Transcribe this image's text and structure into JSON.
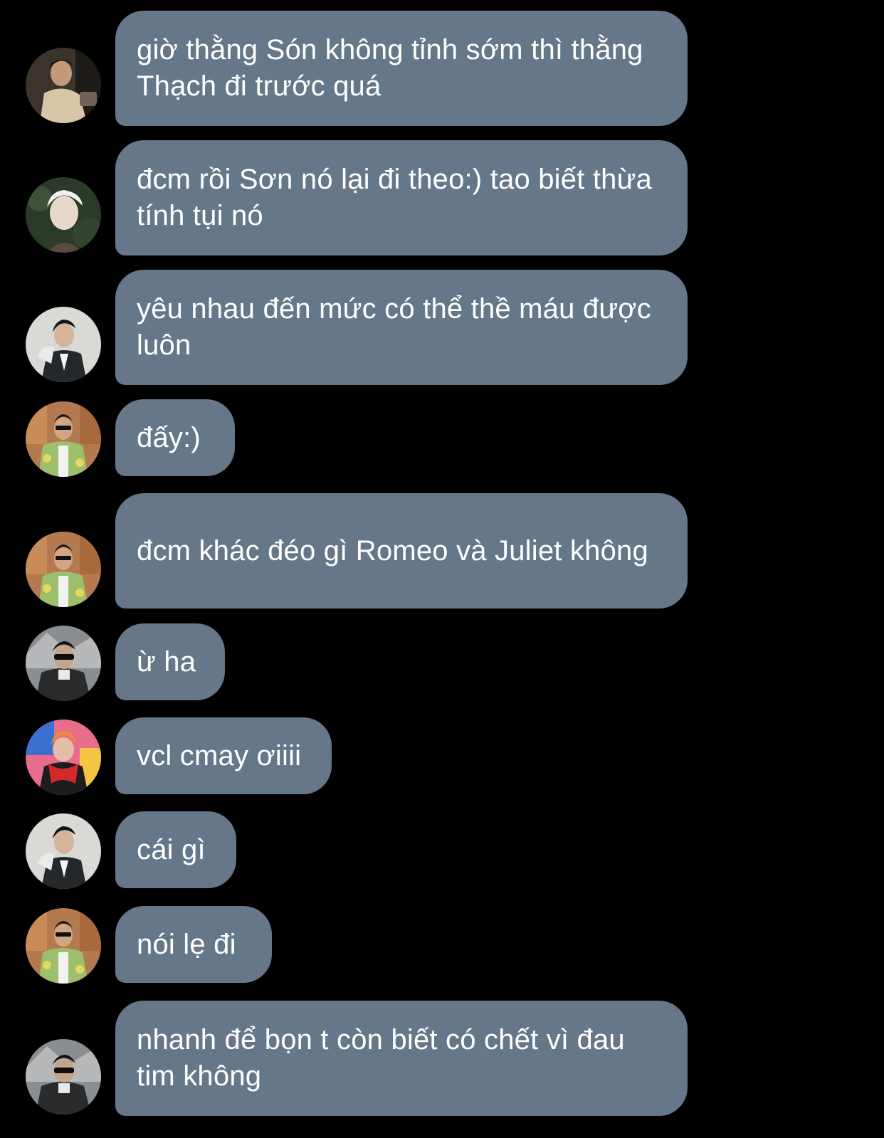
{
  "conversation": {
    "messages": [
      {
        "avatar": "avatar-man-beige-shirt",
        "text": "giờ thằng Són không tỉnh sớm thì thằng Thạch đi trước quá"
      },
      {
        "avatar": "avatar-white-hair",
        "text": "đcm rồi Sơn nó lại đi theo:) tao biết thừa tính tụi nó"
      },
      {
        "avatar": "avatar-man-pinstripe-suit",
        "text": "yêu nhau đến mức có thể thề máu được luôn"
      },
      {
        "avatar": "avatar-man-floral-shirt",
        "text": "đấy:)"
      },
      {
        "avatar": "avatar-man-floral-shirt",
        "text": "đcm khác đéo gì Romeo và Juliet không"
      },
      {
        "avatar": "avatar-man-sunglasses-coat",
        "text": "ừ ha"
      },
      {
        "avatar": "avatar-man-red-scarf",
        "text": "vcl cmay ơiiii"
      },
      {
        "avatar": "avatar-man-pinstripe-suit",
        "text": "cái gì"
      },
      {
        "avatar": "avatar-man-floral-shirt",
        "text": "nói lẹ đi"
      },
      {
        "avatar": "avatar-man-sunglasses-coat",
        "text": "nhanh để bọn t còn biết có chết vì đau tim không"
      }
    ]
  },
  "colors": {
    "background": "#000000",
    "bubble": "#667789",
    "text": "#ffffff"
  }
}
